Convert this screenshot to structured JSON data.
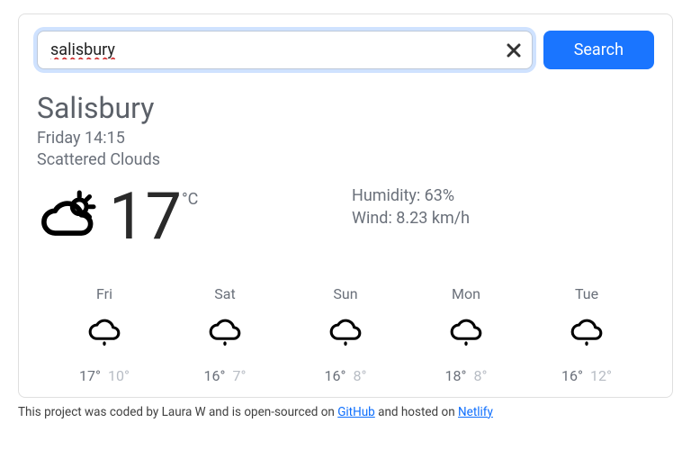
{
  "search": {
    "value": "salisbury",
    "button_label": "Search"
  },
  "location": {
    "city": "Salisbury",
    "datetime": "Friday 14:15",
    "conditions": "Scattered Clouds"
  },
  "current": {
    "temp": "17",
    "unit": "°C",
    "humidity_label": "Humidity: 63%",
    "wind_label": "Wind: 8.23 km/h"
  },
  "forecast": [
    {
      "day": "Fri",
      "hi": "17°",
      "lo": "10°"
    },
    {
      "day": "Sat",
      "hi": "16°",
      "lo": "7°"
    },
    {
      "day": "Sun",
      "hi": "16°",
      "lo": "8°"
    },
    {
      "day": "Mon",
      "hi": "18°",
      "lo": "8°"
    },
    {
      "day": "Tue",
      "hi": "16°",
      "lo": "12°"
    }
  ],
  "footer": {
    "t1": "This project was coded by Laura W and is open-sourced on ",
    "link1": "GitHub",
    "t2": " and hosted on ",
    "link2": "Netlify"
  }
}
